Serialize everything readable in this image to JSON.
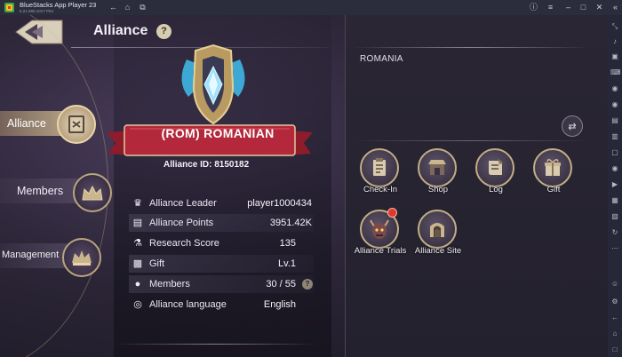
{
  "window": {
    "title": "BlueStacks App Player 23",
    "version": "5.21.580.1017  P64"
  },
  "header": {
    "title": "Alliance",
    "help": "?"
  },
  "nav": {
    "items": [
      {
        "label": "Alliance",
        "active": true
      },
      {
        "label": "Members",
        "active": false
      },
      {
        "label": "Management",
        "active": false
      }
    ]
  },
  "alliance": {
    "banner_name": "(ROM) ROMANIAN",
    "id_label": "Alliance ID:",
    "id_value": "8150182"
  },
  "stats": [
    {
      "icon": "crown-icon",
      "label": "Alliance Leader",
      "value": "player1000434"
    },
    {
      "icon": "chart-icon",
      "label": "Alliance Points",
      "value": "3951.42K"
    },
    {
      "icon": "flask-icon",
      "label": "Research Score",
      "value": "135"
    },
    {
      "icon": "gift-icon",
      "label": "Gift",
      "value": "Lv.1"
    },
    {
      "icon": "person-icon",
      "label": "Members",
      "value": "30 / 55",
      "help": "?"
    },
    {
      "icon": "globe-icon",
      "label": "Alliance language",
      "value": "English"
    }
  ],
  "right": {
    "region": "ROMANIA",
    "actions": [
      {
        "label": "Check-In",
        "icon": "clipboard-icon"
      },
      {
        "label": "Shop",
        "icon": "shop-icon"
      },
      {
        "label": "Log",
        "icon": "scroll-icon"
      },
      {
        "label": "Gift",
        "icon": "gift-icon"
      },
      {
        "label": "Alliance Trials",
        "icon": "demon-icon",
        "notification": true
      },
      {
        "label": "Alliance Site",
        "icon": "gate-icon"
      }
    ]
  },
  "colors": {
    "banner_red": "#b3283a",
    "gold": "#c2ae86",
    "panel": "#2a2634"
  }
}
